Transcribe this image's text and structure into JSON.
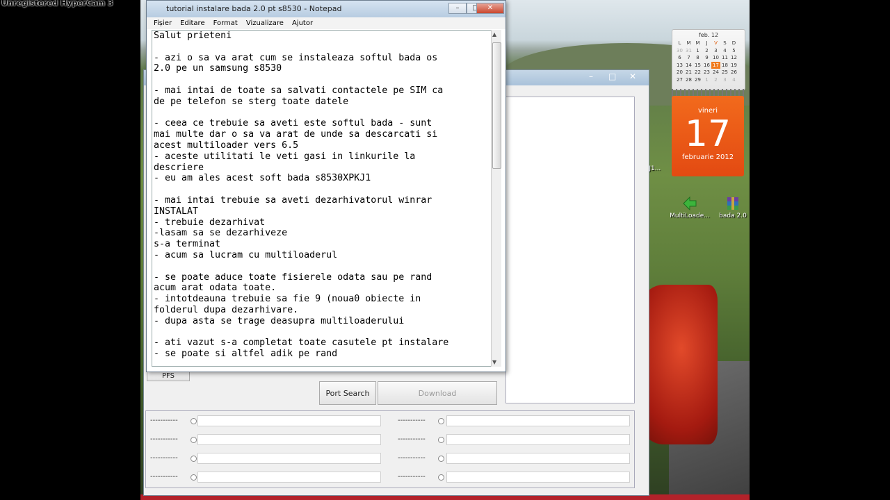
{
  "hypercam": "Unregistered HyperCam 3",
  "notepad": {
    "title": "tutorial instalare bada 2.0 pt s8530 - Notepad",
    "menu": [
      "Fișier",
      "Editare",
      "Format",
      "Vizualizare",
      "Ajutor"
    ],
    "text": "Salut prieteni\n\n- azi o sa va arat cum se instaleaza softul bada os\n2.0 pe un samsung s8530\n\n- mai intai de toate sa salvati contactele pe SIM ca\nde pe telefon se sterg toate datele\n\n- ceea ce trebuie sa aveti este softul bada - sunt\nmai multe dar o sa va arat de unde sa descarcati si\nacest multiloader vers 6.5\n- aceste utilitati le veti gasi in linkurile la\ndescriere\n- eu am ales acest soft bada s8530XPKJ1\n\n- mai intai trebuie sa aveti dezarhivatorul winrar\nINSTALAT\n- trebuie dezarhivat\n-lasam sa se dezarhiveze\ns-a terminat\n- acum sa lucram cu multiloaderul\n\n- se poate aduce toate fisierele odata sau pe rand\nacum arat odata toate.\n- intotdeauna trebuie sa fie 9 (noua0 obiecte in\nfolderul dupa dezarhivare.\n- dupa asta se trage deasupra multiloaderului\n\n- ati vazut s-a completat toate casutele pt instalare\n- se poate si altfel adik pe rand"
  },
  "multiloader": {
    "tab_pfs": "PFS",
    "port_search": "Port Search",
    "download": "Download",
    "port_rows": [
      "-----------",
      "-----------",
      "-----------",
      "-----------"
    ]
  },
  "calendar": {
    "month_title": "feb. 12",
    "weekdays": [
      "L",
      "M",
      "M",
      "J",
      "V",
      "S",
      "D"
    ],
    "days": [
      "30",
      "31",
      "1",
      "2",
      "3",
      "4",
      "5",
      "6",
      "7",
      "8",
      "9",
      "10",
      "11",
      "12",
      "13",
      "14",
      "15",
      "16",
      "17",
      "18",
      "19",
      "20",
      "21",
      "22",
      "23",
      "24",
      "25",
      "26",
      "27",
      "28",
      "29",
      "1",
      "2",
      "3",
      "4"
    ],
    "day_name": "vineri",
    "day_number": "17",
    "month_year": "februarie 2012"
  },
  "desktop_icons": [
    {
      "label": "MultiLoade...",
      "icon": "green-arrow-icon",
      "color": "#3cb43c"
    },
    {
      "label": "bada 2.0",
      "icon": "winrar-archive-icon",
      "color": "#6b3fa0"
    }
  ],
  "partial_label": "PKJ1..."
}
